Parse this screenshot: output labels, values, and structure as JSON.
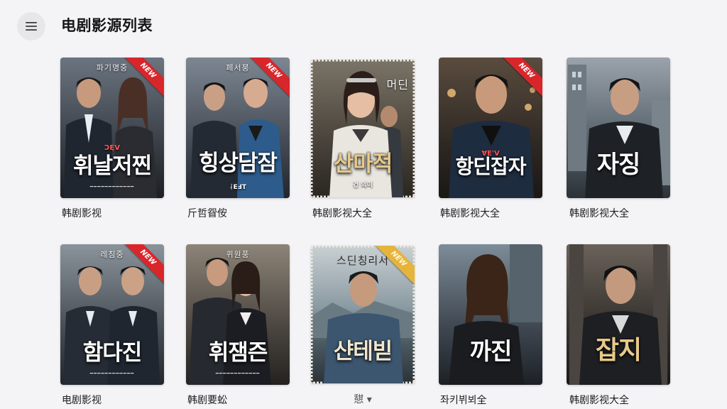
{
  "header": {
    "title": "电剧影源列表",
    "menu_icon": "hamburger-menu-icon"
  },
  "colors": {
    "background": "#f4f4f6",
    "ribbon_red": "#d9262b",
    "ribbon_gold": "#e6b43a"
  },
  "cards": [
    {
      "caption": "韩剧影视",
      "top_text": "파기명중",
      "title": "휘날저찐",
      "tag": "ƆĘV",
      "badge": "NEW"
    },
    {
      "caption": "斤哲眢侒",
      "top_text": "페서붕",
      "title": "힝상담잠",
      "tag": "ᛆEℲT",
      "badge": "NEW"
    },
    {
      "caption": "韩剧影视大全",
      "top_text": "머딘",
      "title": "산마적",
      "tag": "건 의미",
      "badge": ""
    },
    {
      "caption": "韩剧影视大全",
      "top_text": "",
      "title": "항딘잡자",
      "tag": "ⱯE'V",
      "badge": "NEW"
    },
    {
      "caption": "韩剧影视大全",
      "top_text": "",
      "title": "자징",
      "tag": "",
      "badge": ""
    },
    {
      "caption": "电剧影视",
      "top_text": "레침중",
      "title": "함다진",
      "tag": "",
      "badge": "NEW"
    },
    {
      "caption": "韩剧要蚣",
      "top_text": "퀴원풍",
      "title": "휘잼즌",
      "tag": "",
      "badge": ""
    },
    {
      "caption": "憇 ▾",
      "top_text": "스딘칭리서",
      "title": "샨테빋",
      "tag": "",
      "badge": "NEW"
    },
    {
      "caption": "좌키뷔뵈全",
      "top_text": "",
      "title": "까진",
      "tag": "",
      "badge": ""
    },
    {
      "caption": "韩剧影视大全",
      "top_text": "",
      "title": "잡지",
      "tag": "",
      "badge": ""
    }
  ]
}
